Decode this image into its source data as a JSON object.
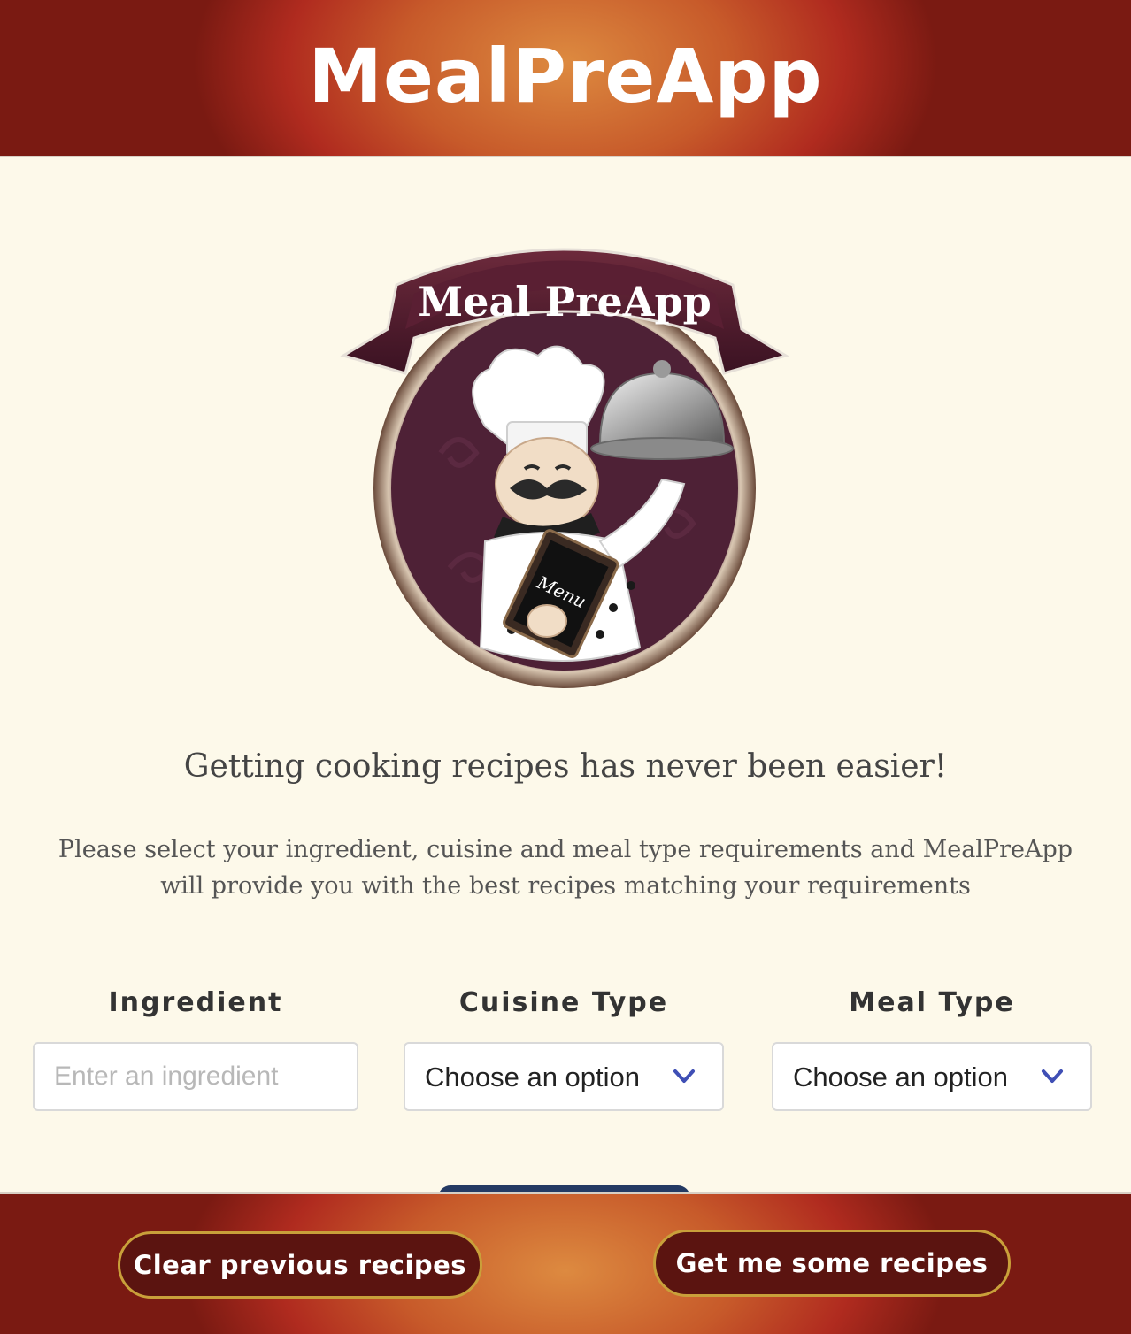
{
  "header": {
    "title": "MealPreApp"
  },
  "logo": {
    "banner_text": "Meal PreApp",
    "menu_text": "Menu"
  },
  "intro": {
    "headline": "Getting cooking recipes has never been easier!",
    "description": "Please select your ingredient, cuisine and meal type requirements and MealPreApp will provide you with the best recipes matching your requirements"
  },
  "form": {
    "ingredient": {
      "label": "Ingredient",
      "placeholder": "Enter an ingredient",
      "value": ""
    },
    "cuisine": {
      "label": "Cuisine Type",
      "selected": "Choose an option"
    },
    "meal": {
      "label": "Meal Type",
      "selected": "Choose an option"
    }
  },
  "footer": {
    "clear_label": "Clear previous recipes",
    "get_label": "Get me some recipes"
  },
  "colors": {
    "header_center": "#dd8a40",
    "header_edge": "#b02b1f",
    "background": "#fdf9ea",
    "button_fill": "#5b1410",
    "button_border": "#c9a03a",
    "chevron": "#3f4fb5"
  }
}
